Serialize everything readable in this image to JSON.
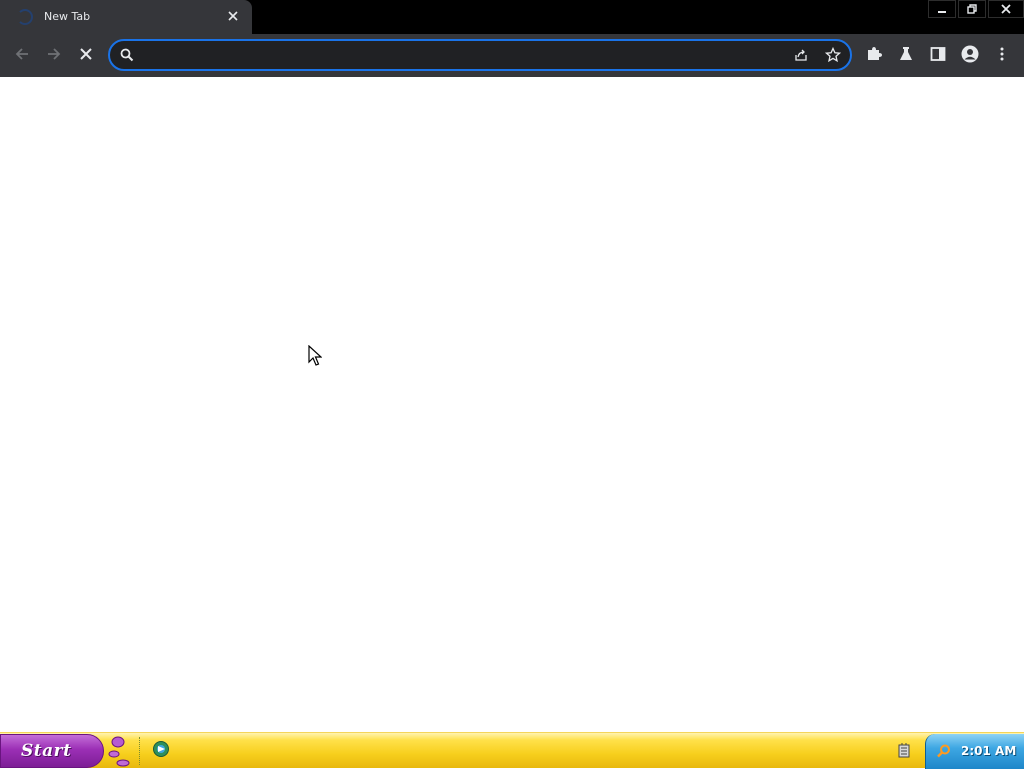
{
  "browser": {
    "tab": {
      "title": "New Tab",
      "close_icon": "close-icon",
      "loading": true
    },
    "window_controls": {
      "minimize_icon": "minimize-icon",
      "restore_icon": "restore-icon",
      "close_icon": "close-icon"
    },
    "toolbar": {
      "back_icon": "arrow-left-icon",
      "forward_icon": "arrow-right-icon",
      "stop_icon": "stop-x-icon",
      "omnibox": {
        "value": "",
        "placeholder": "",
        "search_icon": "search-icon",
        "share_icon": "share-icon",
        "bookmark_icon": "star-icon"
      },
      "extensions_icon": "puzzle-icon",
      "labs_icon": "flask-icon",
      "side_panel_icon": "side-panel-icon",
      "profile_icon": "avatar-icon",
      "menu_icon": "kebab-menu-icon"
    },
    "colors": {
      "frame": "#000000",
      "tab_active": "#35363a",
      "toolbar": "#35363a",
      "omnibox_bg": "#202124",
      "omnibox_focus_ring": "#1a73e8",
      "icon": "#e8eaed"
    }
  },
  "taskbar": {
    "start_label": "Start",
    "quick_launch_icon": "browser-globe-icon",
    "tray_icon": "network-icon",
    "clock_search_icon": "search-icon",
    "clock": "2:01 AM",
    "colors": {
      "bar": "#f7cf1d",
      "start": "#9b2fb5",
      "clock_area": "#3ea7e3"
    }
  }
}
